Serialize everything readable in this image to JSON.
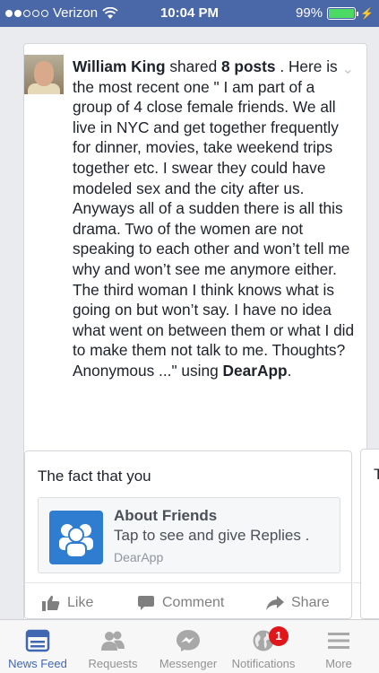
{
  "status_bar": {
    "carrier": "Verizon",
    "time": "10:04 PM",
    "battery": "99%",
    "battery_level": 0.99,
    "signal_dots_filled": 2,
    "signal_dots_total": 5
  },
  "post": {
    "author": "William King",
    "action_text": "shared",
    "count_text": "8 posts",
    "body": ". Here is the most recent one \" I am part of a group of 4 close female friends. We all live in NYC and get together frequently for dinner, movies, take weekend trips together etc. I swear they could have modeled sex and the city after us. Anyways all of a sudden there is all this drama. Two of the women are not speaking to each other and won’t tell me why and won’t see me anymore either. The third woman I think knows what is going on but won’t say. I have no idea what went on between them or what I did to make them not talk to me. Thoughts? Anonymous ...\" using",
    "app_link": "DearApp",
    "end_punct": "."
  },
  "attachment": {
    "title": "The fact that you",
    "app_name": "About Friends",
    "app_subtitle": "Tap to see and give Replies .",
    "app_source": "DearApp"
  },
  "actions": {
    "like": "Like",
    "comment": "Comment",
    "share": "Share"
  },
  "peek_card": {
    "title": "T"
  },
  "tabbar": {
    "tabs": [
      {
        "label": "News Feed",
        "icon": "news-feed-icon",
        "active": true
      },
      {
        "label": "Requests",
        "icon": "requests-icon",
        "active": false
      },
      {
        "label": "Messenger",
        "icon": "messenger-icon",
        "active": false
      },
      {
        "label": "Notifications",
        "icon": "globe-icon",
        "active": false,
        "badge": "1"
      },
      {
        "label": "More",
        "icon": "menu-icon",
        "active": false
      }
    ]
  },
  "colors": {
    "brand": "#4a67a8",
    "active_tab": "#4267b2",
    "badge": "#e0161b",
    "battery": "#4cd964"
  }
}
